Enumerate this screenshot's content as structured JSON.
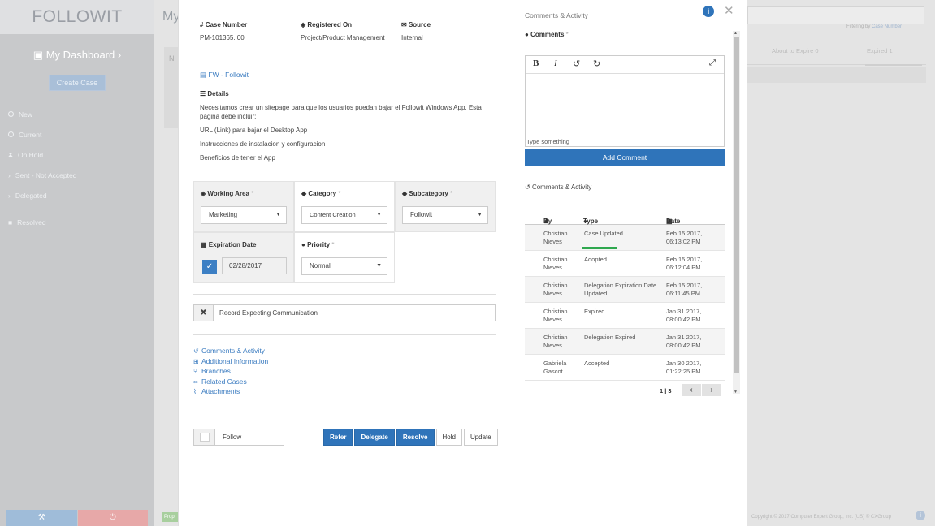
{
  "sidebar": {
    "logo": "FOLLOWIT",
    "dashboard_title": "My Dashboard",
    "create_case": "Create Case",
    "items": [
      {
        "label": "New"
      },
      {
        "label": "Current"
      },
      {
        "label": "On Hold"
      },
      {
        "label": "Sent - Not Accepted"
      },
      {
        "label": "Delegated"
      },
      {
        "label": "Resolved"
      }
    ],
    "bottom_left_icon": "wrench-icon",
    "bottom_right_icon": "power-icon"
  },
  "background": {
    "title": "My",
    "panel_text": "N",
    "filter_label": "Filtering by",
    "filter_link": "Case Number",
    "tabs": [
      "About to Expire",
      "Expired"
    ],
    "tab_counts": [
      "0",
      "1"
    ],
    "footer": "Copyright © 2017 Computer Expert Group, Inc. (US) ® CXGroup",
    "badge": "Prop"
  },
  "modal": {
    "case_number": {
      "label": "Case Number",
      "value": "PM-101365. 00"
    },
    "registered_on": {
      "label": "Registered On",
      "value": "Project/Product Management"
    },
    "source": {
      "label": "Source",
      "value": "Internal"
    },
    "fw_link": "FW - Followit",
    "details": {
      "label": "Details",
      "lines": [
        "Necesitamos crear un sitepage para que los usuarios puedan bajar el Followit Windows App. Esta pagina debe incluir:",
        "URL (Link) para bajar el Desktop App",
        "Instrucciones de instalacion y configuracion",
        "Beneficios de tener el App"
      ]
    },
    "working_area": {
      "label": "Working Area",
      "value": "Marketing"
    },
    "category": {
      "label": "Category",
      "value": "Content Creation"
    },
    "subcategory": {
      "label": "Subcategory",
      "value": "Followit"
    },
    "expiration_date": {
      "label": "Expiration Date",
      "value": "02/28/2017"
    },
    "priority": {
      "label": "Priority",
      "value": "Normal"
    },
    "required_mark": "*",
    "record": "Record Expecting Communication",
    "links": [
      {
        "label": "Comments & Activity",
        "icon": "history-icon"
      },
      {
        "label": "Additional Information",
        "icon": "plus-square-icon"
      },
      {
        "label": "Branches",
        "icon": "branch-icon"
      },
      {
        "label": "Related Cases",
        "icon": "link-icon"
      },
      {
        "label": "Attachments",
        "icon": "paperclip-icon"
      }
    ],
    "follow": "Follow",
    "buttons": {
      "refer": "Refer",
      "delegate": "Delegate",
      "resolve": "Resolve",
      "hold": "Hold",
      "update": "Update"
    }
  },
  "right": {
    "title": "Comments & Activity",
    "comments_label": "Comments",
    "editor_placeholder": "Type something",
    "add_comment": "Add Comment",
    "activity_title": "Comments & Activity",
    "columns": {
      "by": "By",
      "type": "Type",
      "date": "Date"
    },
    "rows": [
      {
        "by": "Christian Nieves",
        "type": "Case Updated",
        "date": "Feb 15 2017, 06:13:02 PM"
      },
      {
        "by": "Christian Nieves",
        "type": "Adopted",
        "date": "Feb 15 2017, 06:12:04 PM"
      },
      {
        "by": "Christian Nieves",
        "type": "Delegation Expiration Date Updated",
        "date": "Feb 15 2017, 06:11:45 PM"
      },
      {
        "by": "Christian Nieves",
        "type": "Expired",
        "date": "Jan 31 2017, 08:00:42 PM"
      },
      {
        "by": "Christian Nieves",
        "type": "Delegation Expired",
        "date": "Jan 31 2017, 08:00:42 PM"
      },
      {
        "by": "Gabriela Gascot",
        "type": "Accepted",
        "date": "Jan 30 2017, 01:22:25 PM"
      }
    ],
    "pager": "1 | 3"
  },
  "colors": {
    "primary": "#2f74ba",
    "success": "#2fa84f"
  }
}
